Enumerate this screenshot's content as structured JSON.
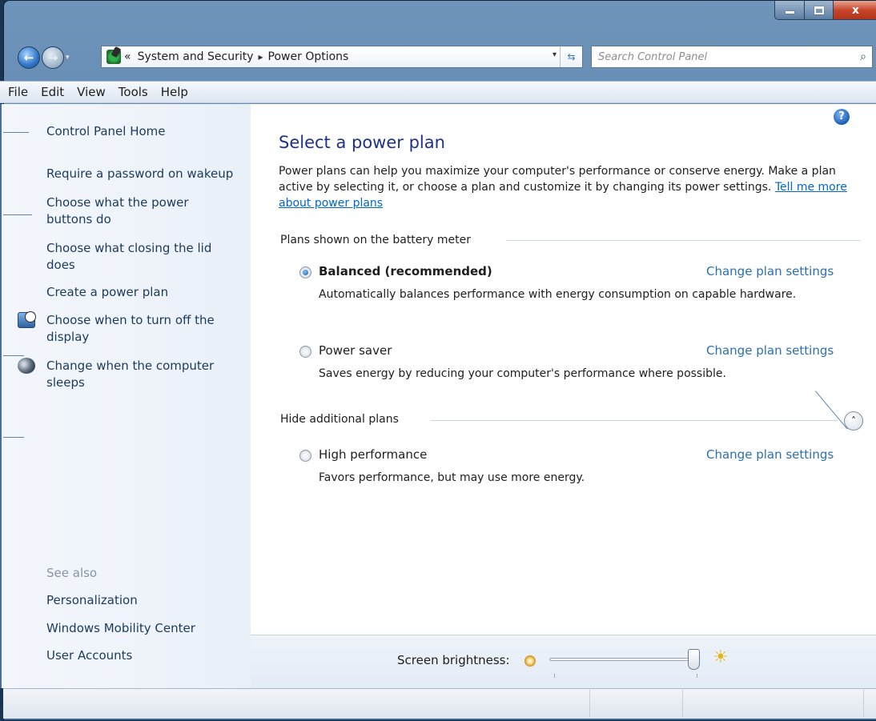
{
  "window": {
    "caption": {
      "minimize_icon": "minimize-icon",
      "maximize_icon": "maximize-icon",
      "close_glyph": "x"
    }
  },
  "nav": {
    "back_glyph": "←",
    "forward_glyph": "→",
    "history_glyph": "▾"
  },
  "address": {
    "overflow": "«",
    "crumbs": [
      "System and Security",
      "Power Options"
    ],
    "separator": "▸",
    "dropdown": "▾",
    "refresh": "⇆"
  },
  "search": {
    "placeholder": "Search Control Panel",
    "icon": "⌕"
  },
  "menu": [
    "File",
    "Edit",
    "View",
    "Tools",
    "Help"
  ],
  "sidebar": {
    "links": [
      {
        "label": "Control Panel Home"
      },
      {
        "label": "Require a password on wakeup"
      },
      {
        "label": "Choose what the power buttons do"
      },
      {
        "label": "Choose what closing the lid does"
      },
      {
        "label": "Create a power plan"
      },
      {
        "label": "Choose when to turn off the display",
        "icon": "display-timer-icon"
      },
      {
        "label": "Change when the computer sleeps",
        "icon": "sleep-moon-icon"
      }
    ],
    "see_also_title": "See also",
    "see_also": [
      "Personalization",
      "Windows Mobility Center",
      "User Accounts"
    ]
  },
  "main": {
    "help_glyph": "?",
    "title": "Select a power plan",
    "intro": "Power plans can help you maximize your computer's performance or conserve energy. Make a plan active by selecting it, or choose a plan and customize it by changing its power settings.",
    "intro_link": "Tell me more about power plans",
    "battery_section": "Plans shown on the battery meter",
    "plans": [
      {
        "name": "Balanced (recommended)",
        "description": "Automatically balances performance with energy consumption on capable hardware.",
        "selected": true,
        "link": "Change plan settings"
      },
      {
        "name": "Power saver",
        "description": "Saves energy by reducing your computer's performance where possible.",
        "selected": false,
        "link": "Change plan settings"
      }
    ],
    "additional_section": "Hide additional plans",
    "collapse_glyph": "˄",
    "additional_plans": [
      {
        "name": "High performance",
        "description": "Favors performance, but may use more energy.",
        "selected": false,
        "link": "Change plan settings"
      }
    ]
  },
  "brightness": {
    "label": "Screen brightness:",
    "value": 1.0,
    "bright_icon": "☀"
  },
  "colors": {
    "link": "#2b6fb3",
    "title": "#1e3287",
    "sidebar_link": "#1b3a5b",
    "see_also": "#8595a6"
  }
}
